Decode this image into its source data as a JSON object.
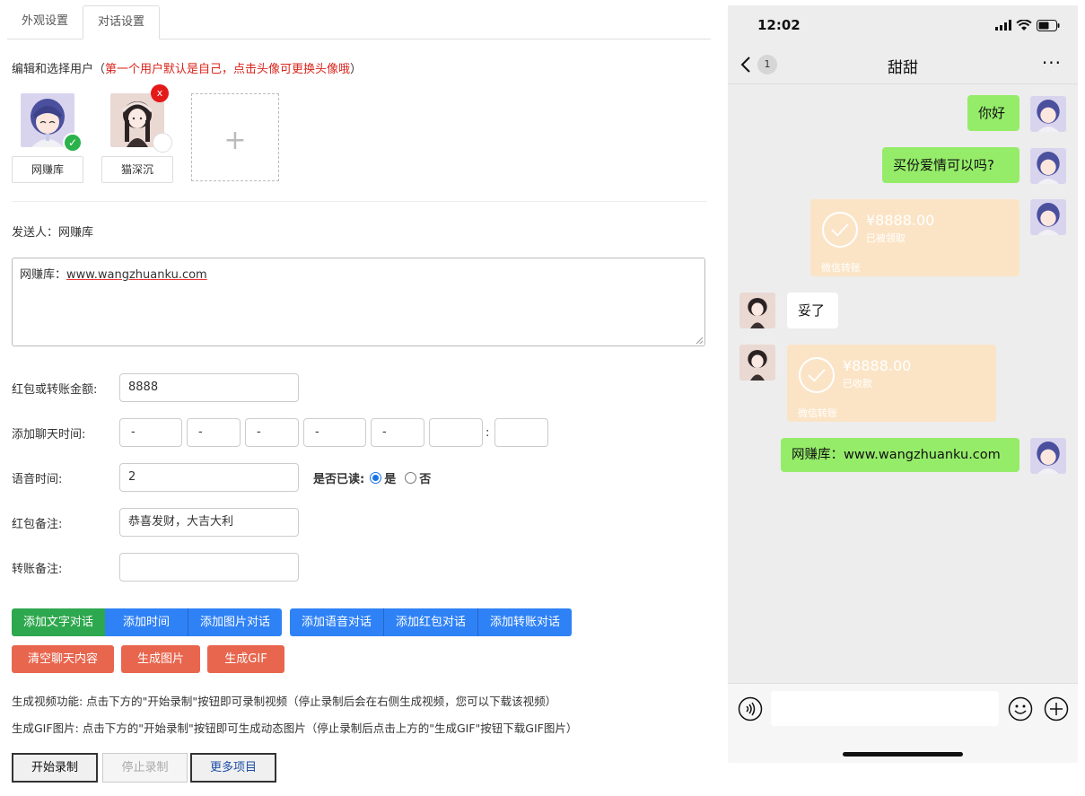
{
  "tabs": [
    "外观设置",
    "对话设置"
  ],
  "user_hint": {
    "prefix": "编辑和选择用户（",
    "red": "第一个用户默认是自己，点击头像可更换头像哦",
    "suffix": "）"
  },
  "users": [
    {
      "name": "网赚库",
      "selected": true
    },
    {
      "name": "猫深沉",
      "selected": false
    }
  ],
  "delete_label": "x",
  "add_label": "+",
  "sender": "发送人：网赚库",
  "message_text": {
    "prefix": "网赚库：",
    "url": "www.wangzhuanku.com"
  },
  "form": {
    "amount_label": "红包或转账金额:",
    "amount_value": "8888",
    "time_label": "添加聊天时间:",
    "time_selects": [
      "-",
      "-",
      "-",
      "-",
      "-",
      "",
      ""
    ],
    "time_colon": ":",
    "voice_label": "语音时间:",
    "voice_value": "2",
    "read_label": "是否已读:",
    "read_yes": "是",
    "read_no": "否",
    "redpacket_note_label": "红包备注:",
    "redpacket_note_value": "恭喜发财，大吉大利",
    "transfer_note_label": "转账备注:",
    "transfer_note_value": ""
  },
  "buttons": {
    "add_text": "添加文字对话",
    "add_time": "添加时间",
    "add_image": "添加图片对话",
    "add_voice": "添加语音对话",
    "add_redpacket": "添加红包对话",
    "add_transfer": "添加转账对话",
    "clear": "清空聊天内容",
    "gen_image": "生成图片",
    "gen_gif": "生成GIF"
  },
  "info": {
    "video": "生成视频功能: 点击下方的\"开始录制\"按钮即可录制视频（停止录制后会在右侧生成视频，您可以下载该视频）",
    "gif": "生成GIF图片: 点击下方的\"开始录制\"按钮即可生成动态图片（停止录制后点击上方的\"生成GIF\"按钮下载GIF图片）"
  },
  "record": {
    "start": "开始录制",
    "stop": "停止录制",
    "more": "更多项目"
  },
  "phone": {
    "time": "12:02",
    "unread": "1",
    "title": "甜甜",
    "more": "···",
    "messages": [
      {
        "side": "right",
        "type": "text",
        "text": "你好"
      },
      {
        "side": "right",
        "type": "text",
        "text": "买份爱情可以吗?"
      },
      {
        "side": "right",
        "type": "transfer",
        "amount": "¥8888.00",
        "state": "已被领取",
        "foot": "微信转账"
      },
      {
        "side": "left",
        "type": "text",
        "text": "妥了"
      },
      {
        "side": "left",
        "type": "transfer",
        "amount": "¥8888.00",
        "state": "已收款",
        "foot": "微信转账"
      },
      {
        "side": "right",
        "type": "text",
        "text": "网赚库：www.wangzhuanku.com"
      }
    ]
  },
  "colors": {
    "wechat_green": "#95ec69",
    "transfer": "#fbe4c6",
    "btn_blue": "#2f82f6",
    "btn_green": "#2ea84e",
    "btn_red": "#e8664e"
  }
}
